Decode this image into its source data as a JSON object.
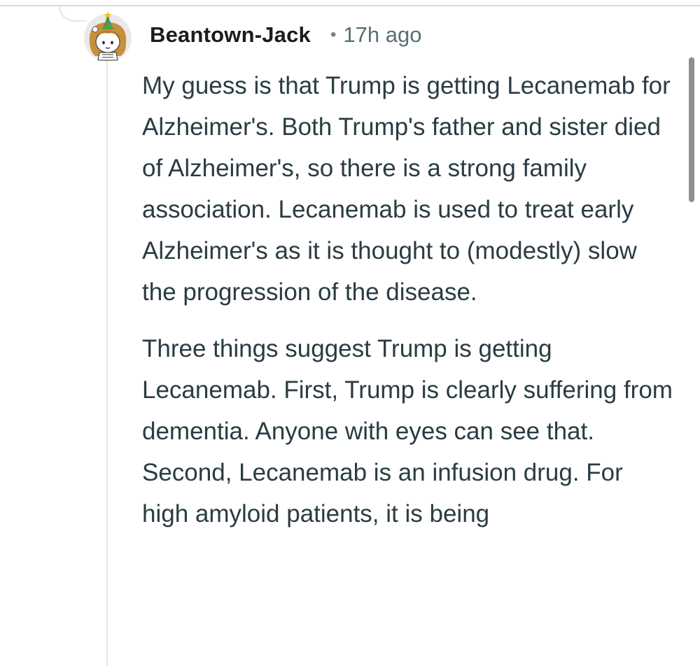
{
  "comment": {
    "author": "Beantown-Jack",
    "separator": "•",
    "timestamp": "17h ago",
    "avatar_icon": "snoo-avatar-icon",
    "paragraphs": [
      "My guess is that Trump is getting Lecanemab for Alzheimer's. Both Trump's father and sister died of Alzheimer's, so there is a strong family association. Lecanemab is used to treat early Alzheimer's as it is thought to (modestly) slow the progression of the disease.",
      "Three things suggest Trump is getting Lecanemab. First, Trump is clearly suffering from dementia. Anyone with eyes can see that. Second, Lecanemab is an infusion drug. For high amyloid patients, it is being"
    ]
  },
  "colors": {
    "text": "#2a3c42",
    "author": "#1c1c1c",
    "meta": "#576f76",
    "thread_line": "#e4e6e8"
  }
}
